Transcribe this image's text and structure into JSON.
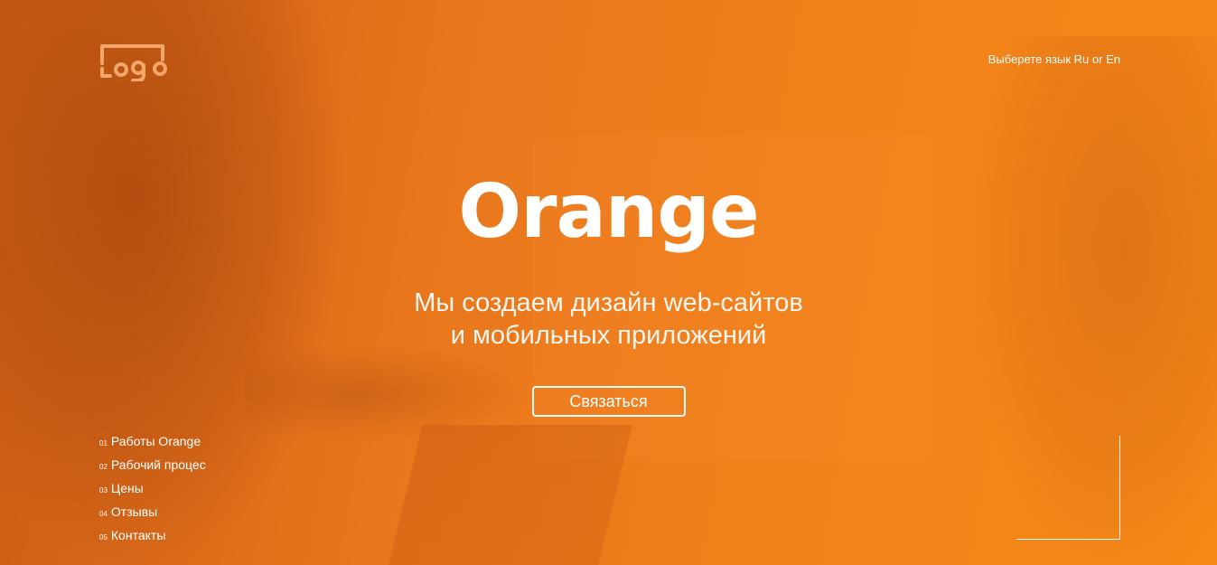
{
  "logo": {
    "text": "Logo",
    "color": "#f2a66b"
  },
  "language": {
    "prefix": "Выберете язык",
    "ru": "Ru",
    "separator": "or",
    "en": "En"
  },
  "hero": {
    "title": "Orange",
    "subtitle_line1": "Мы создаем дизайн web-сайтов",
    "subtitle_line2": "и мобильных приложений",
    "cta_label": "Связаться"
  },
  "nav": {
    "items": [
      {
        "num": "01",
        "label": "Работы Orange"
      },
      {
        "num": "02",
        "label": "Рабочий процес"
      },
      {
        "num": "03",
        "label": "Цены"
      },
      {
        "num": "04",
        "label": "Отзывы"
      },
      {
        "num": "05",
        "label": "Контакты"
      }
    ]
  },
  "colors": {
    "accent": "#f58a17",
    "overlay_dark": "#c95a14",
    "text": "#ffffff"
  }
}
